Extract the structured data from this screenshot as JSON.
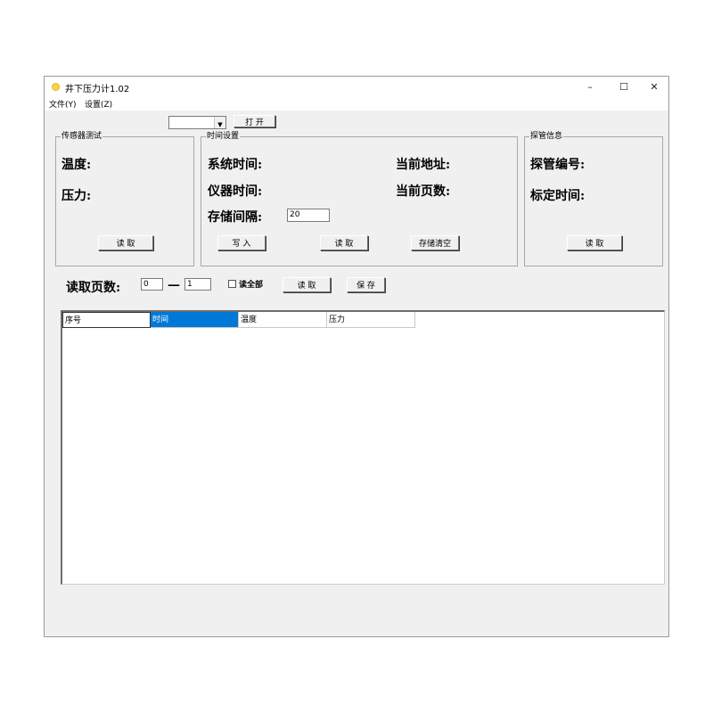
{
  "window": {
    "title": "井下压力计1.02",
    "minimize": "–",
    "maximize": "☐",
    "close": "✕"
  },
  "menu": {
    "file": "文件(Y)",
    "settings": "设置(Z)"
  },
  "toolbar": {
    "port_value": "",
    "open_label": "打 开"
  },
  "sensor_test": {
    "group_label": "传感器测试",
    "temperature_label": "温度:",
    "pressure_label": "压力:",
    "read_label": "读 取"
  },
  "time_settings": {
    "group_label": "时间设置",
    "system_time_label": "系统时间:",
    "instrument_time_label": "仪器时间:",
    "storage_interval_label": "存储间隔:",
    "storage_interval_value": "20",
    "current_address_label": "当前地址:",
    "current_page_label": "当前页数:",
    "write_label": "写 入",
    "read_label": "读 取",
    "clear_storage_label": "存储清空"
  },
  "probe_info": {
    "group_label": "探管信息",
    "probe_number_label": "探管编号:",
    "calibration_time_label": "标定时间:",
    "read_label": "读 取"
  },
  "read_pages": {
    "label": "读取页数:",
    "from_value": "0",
    "separator": "—",
    "to_value": "1",
    "read_all_label": "读全部",
    "read_all_checked": false,
    "read_label": "读 取",
    "save_label": "保 存"
  },
  "table": {
    "columns": [
      "序号",
      "时间",
      "温度",
      "压力"
    ],
    "selected_column": 1,
    "rows": []
  },
  "colors": {
    "accent": "#0078d7",
    "window_bg": "#f0f0f0"
  }
}
